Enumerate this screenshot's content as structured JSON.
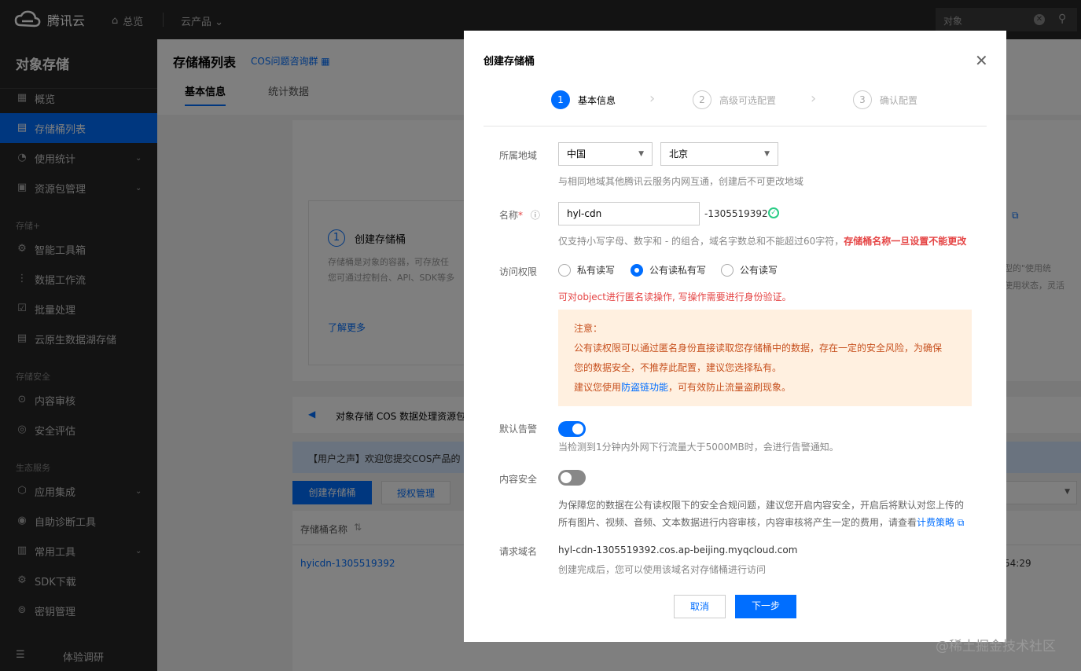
{
  "topbar": {
    "brand": "腾讯云",
    "home": "总览",
    "products": "云产品 ⌄",
    "search_placeholder": "对象"
  },
  "sidebar": {
    "title": "对象存储",
    "items": [
      {
        "label": "概览",
        "icon": "grid-icon"
      },
      {
        "label": "存储桶列表",
        "icon": "bucket-icon",
        "active": true
      },
      {
        "label": "使用统计",
        "icon": "chart-icon",
        "caret": true
      },
      {
        "label": "资源包管理",
        "icon": "package-icon",
        "caret": true
      }
    ],
    "group_storage": "存储+",
    "items2": [
      {
        "label": "智能工具箱",
        "icon": "toolbox-icon"
      },
      {
        "label": "数据工作流",
        "icon": "workflow-icon"
      },
      {
        "label": "批量处理",
        "icon": "batch-icon"
      },
      {
        "label": "云原生数据湖存储",
        "icon": "datalake-icon"
      }
    ],
    "group_security": "存储安全",
    "items3": [
      {
        "label": "内容审核",
        "icon": "audit-icon"
      },
      {
        "label": "安全评估",
        "icon": "assess-icon"
      }
    ],
    "group_eco": "生态服务",
    "items4": [
      {
        "label": "应用集成",
        "icon": "integration-icon",
        "caret": true
      },
      {
        "label": "自助诊断工具",
        "icon": "diagnose-icon"
      },
      {
        "label": "常用工具",
        "icon": "tools-icon",
        "caret": true
      },
      {
        "label": "SDK下载",
        "icon": "sdk-icon"
      },
      {
        "label": "密钥管理",
        "icon": "key-icon"
      }
    ],
    "bottom": "体验调研"
  },
  "main": {
    "title": "存储桶列表",
    "group_link": "COS问题咨询群",
    "tabs": [
      "基本信息",
      "统计数据"
    ],
    "card_step": "创建存储桶",
    "card_desc1": "存储桶是对象的容器，可存放任",
    "card_desc2": "您可通过控制台、API、SDK等多",
    "card_more": "了解更多",
    "right_text1": "型的\"使用统",
    "right_text2": "使用状态，灵活",
    "notice": "对象存储 COS 数据处理资源包",
    "banner": "【用户之声】欢迎您提交COS产品的",
    "create_btn": "创建存储桶",
    "auth_btn": "授权管理",
    "col_name": "存储桶名称",
    "row_name": "hyicdn-1305519392",
    "row_time": "54:29"
  },
  "dialog": {
    "title": "创建存储桶",
    "steps": [
      "基本信息",
      "高级可选配置",
      "确认配置"
    ],
    "step_nums": [
      "1",
      "2",
      "3"
    ],
    "region_label": "所属地域",
    "region_country": "中国",
    "region_city": "北京",
    "region_hint": "与相同地域其他腾讯云服务内网互通，创建后不可更改地域",
    "name_label": "名称",
    "name_required": "*",
    "name_value": "hyl-cdn",
    "name_suffix": "-1305519392",
    "name_hint": "仅支持小写字母、数字和 - 的组合，域名字数总和不能超过60字符，",
    "name_hint_red": "存储桶名称一旦设置不能更改",
    "access_label": "访问权限",
    "access_options": [
      "私有读写",
      "公有读私有写",
      "公有读写"
    ],
    "access_warn": "可对object进行匿名读操作, 写操作需要进行身份验证。",
    "note_title": "注意：",
    "note_line1": "公有读权限可以通过匿名身份直接读取您存储桶中的数据，存在一定的安全风险，为确保",
    "note_line2": "您的数据安全，不推荐此配置，建议您选择私有。",
    "note_line3_pre": "建议您使用",
    "note_line3_link": "防盗链功能",
    "note_line3_post": "，可有效防止流量盗刷现象。",
    "alarm_label": "默认告警",
    "alarm_on": true,
    "alarm_hint": "当检测到1分钟内外网下行流量大于5000MB时，会进行告警通知。",
    "content_label": "内容安全",
    "content_on": false,
    "content_hint1": "为保障您的数据在公有读权限下的安全合规问题，建议您开启内容安全，开启后将默认对您上传的",
    "content_hint2": "所有图片、视频、音频、文本数据进行内容审核，内容审核将产生一定的费用，请查看",
    "content_link": "计费策略",
    "domain_label": "请求域名",
    "domain_value": "hyl-cdn-1305519392.cos.ap-beijing.myqcloud.com",
    "domain_hint": "创建完成后，您可以使用该域名对存储桶进行访问",
    "cancel": "取消",
    "next": "下一步"
  },
  "watermark": "@稀土掘金技术社区",
  "colors": {
    "accent": "#006eff",
    "sidebar": "#262626",
    "warn_bg": "#fff0e0",
    "error": "#e54545"
  }
}
